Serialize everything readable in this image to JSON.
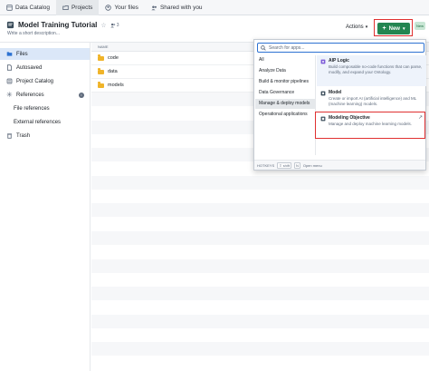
{
  "tabs": [
    {
      "label": "Data Catalog",
      "icon": "catalog-icon"
    },
    {
      "label": "Projects",
      "icon": "projects-icon"
    },
    {
      "label": "Your files",
      "icon": "user-files-icon"
    },
    {
      "label": "Shared with you",
      "icon": "shared-icon"
    }
  ],
  "header": {
    "title": "Model Training Tutorial",
    "member_count": "3",
    "description_placeholder": "Write a short description...",
    "actions_label": "Actions",
    "new_label": "New",
    "beta_label": "New"
  },
  "sidebar": {
    "items": [
      {
        "label": "Files"
      },
      {
        "label": "Autosaved"
      },
      {
        "label": "Project Catalog"
      },
      {
        "label": "References"
      },
      {
        "label": "File references"
      },
      {
        "label": "External references"
      },
      {
        "label": "Trash"
      }
    ]
  },
  "table": {
    "column_name": "NAME",
    "rows": [
      {
        "name": "code"
      },
      {
        "name": "data"
      },
      {
        "name": "models"
      }
    ]
  },
  "menu": {
    "search_placeholder": "Search for apps...",
    "categories": [
      "All",
      "Analyze Data",
      "Build & monitor pipelines",
      "Data Governance",
      "Manage & deploy models",
      "Operational applications"
    ],
    "apps": [
      {
        "name": "AIP Logic",
        "description": "Build composable no-code functions that can parse, modify, and expand your Ontology."
      },
      {
        "name": "Model",
        "description": "Create or import AI (artificial intelligence) and ML (machine learning) models."
      },
      {
        "name": "Modeling Objective",
        "description": "Manage and deploy machine learning models."
      }
    ],
    "footer": {
      "hotkeys": "HOTKEYS",
      "shift": "shift",
      "n": "N",
      "open_menu": "Open menu"
    }
  },
  "colors": {
    "accent": "#238551",
    "highlight_box": "#e03131",
    "selection": "#dbe7f8"
  }
}
